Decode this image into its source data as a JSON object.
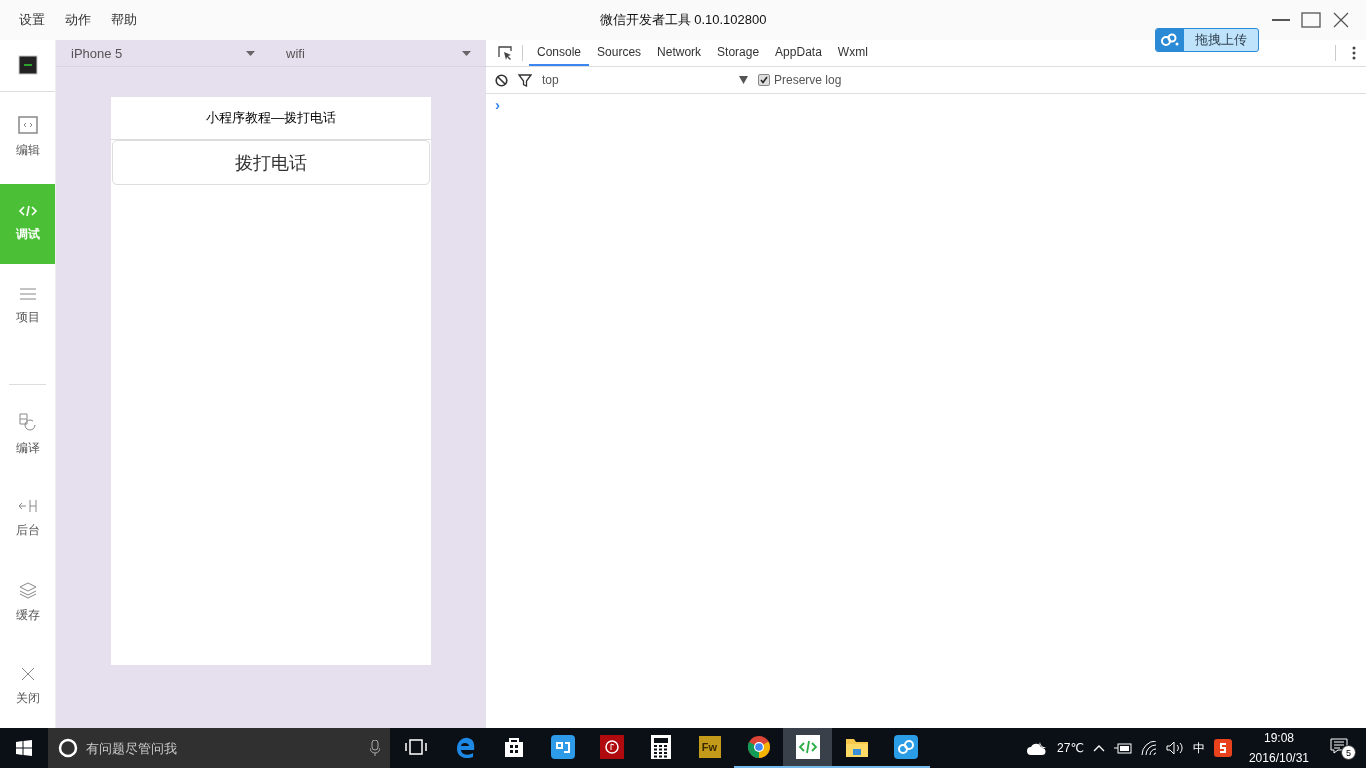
{
  "menu": [
    "设置",
    "动作",
    "帮助"
  ],
  "window": {
    "title": "微信开发者工具 0.10.102800"
  },
  "upload_button": {
    "label": "拖拽上传"
  },
  "sidebar": {
    "top_items": [
      {
        "kind": "simulator",
        "selected": false
      },
      {
        "kind": "editor",
        "label": "编辑",
        "selected": false
      },
      {
        "kind": "debug",
        "label": "调试",
        "selected": true
      },
      {
        "kind": "project",
        "label": "项目",
        "selected": false
      }
    ],
    "bottom_items": [
      {
        "kind": "compile",
        "label": "编译"
      },
      {
        "kind": "background",
        "label": "后台"
      },
      {
        "kind": "cache",
        "label": "缓存"
      },
      {
        "kind": "close",
        "label": "关闭"
      }
    ]
  },
  "simulator": {
    "device": "iPhone 5",
    "network": "wifi",
    "nav_title": "小程序教程—拨打电话",
    "call_button": "拨打电话"
  },
  "devtools": {
    "tabs": [
      {
        "label": "Console",
        "selected": true
      },
      {
        "label": "Sources",
        "selected": false
      },
      {
        "label": "Network",
        "selected": false
      },
      {
        "label": "Storage",
        "selected": false
      },
      {
        "label": "AppData",
        "selected": false
      },
      {
        "label": "Wxml",
        "selected": false
      }
    ],
    "context": "top",
    "preserve_log": {
      "label": "Preserve log",
      "checked": true
    },
    "prompt": "›"
  },
  "taskbar": {
    "search_placeholder": "有问题尽管问我",
    "apps": [
      {
        "kind": "taskview",
        "running": false,
        "active": false
      },
      {
        "kind": "edge",
        "running": false,
        "active": false
      },
      {
        "kind": "store",
        "running": false,
        "active": false
      },
      {
        "kind": "blueapp",
        "running": false,
        "active": false
      },
      {
        "kind": "music",
        "running": false,
        "active": false
      },
      {
        "kind": "calculator",
        "running": false,
        "active": false
      },
      {
        "kind": "fw",
        "label": "Fw",
        "running": false,
        "active": false
      },
      {
        "kind": "chrome",
        "running": true,
        "active": false
      },
      {
        "kind": "devtools",
        "running": true,
        "active": true
      },
      {
        "kind": "folder",
        "running": true,
        "active": false
      },
      {
        "kind": "cloud",
        "running": true,
        "active": false
      }
    ],
    "temperature": "27℃",
    "ime": "中",
    "time": "19:08",
    "date": "2016/10/31",
    "notifications": "5"
  }
}
